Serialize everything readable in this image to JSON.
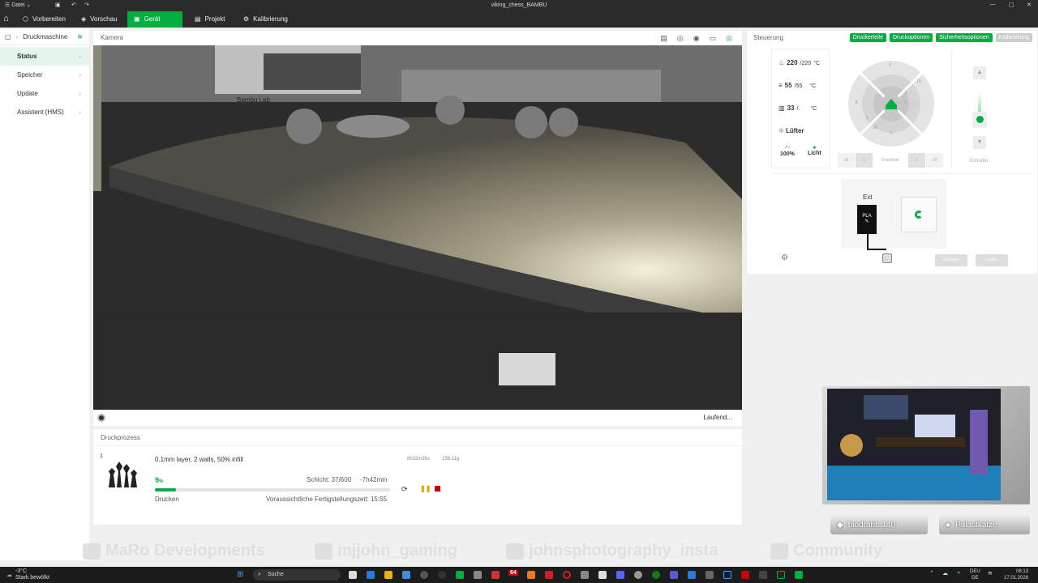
{
  "titlebar": {
    "file_menu": "Datei",
    "title": "viking_chess_BAMBU"
  },
  "nav": {
    "tabs": [
      {
        "label": "Vorbereiten",
        "icon": "cube-icon"
      },
      {
        "label": "Vorschau",
        "icon": "layers-icon"
      },
      {
        "label": "Gerät",
        "icon": "device-icon",
        "active": true
      },
      {
        "label": "Projekt",
        "icon": "project-icon"
      },
      {
        "label": "Kalibrierung",
        "icon": "calibration-icon"
      }
    ]
  },
  "sidebar": {
    "title": "Druckmaschine",
    "items": [
      "Status",
      "Speicher",
      "Update",
      "Assistent (HMS)"
    ]
  },
  "camera": {
    "label": "Kamera",
    "status": "Laufend..."
  },
  "process": {
    "label": "Druckprozess",
    "plate_index": "1",
    "job": "0.1mm layer, 2 walls, 50% infill",
    "time_total": "8h32m36s",
    "weight": "158,11g",
    "percent": "9",
    "percent_unit": "%",
    "progress": 0.09,
    "layer": "Schicht: 37/600",
    "remaining": "-7h42min",
    "state": "Drucken",
    "finish": "Voraussichtliche Fertigstellungszeit: 15:55"
  },
  "control": {
    "label": "Steuerung",
    "buttons": [
      "Druckerteile",
      "Druckoptionen",
      "Sicherheitsoptionen",
      "Kalibrierung"
    ],
    "nozzle": {
      "current": "220",
      "target": "/220",
      "unit": "°C"
    },
    "bed": {
      "current": "55",
      "target": "/55",
      "unit": "°C"
    },
    "chamber": {
      "current": "33",
      "target": "/.",
      "unit": "°C"
    },
    "fan_label": "Lüfter",
    "fan_value": "100%",
    "light_label": "Licht",
    "dpad_labels": [
      "Y",
      "X",
      "-X",
      "-Y",
      "10",
      "1",
      "10",
      "1"
    ],
    "z_labels": [
      "10",
      "1",
      "Druckbett",
      "1",
      "10"
    ],
    "extruder_label": "Extruder",
    "ams": {
      "ext_label": "Ext",
      "filament": "PLA",
      "btn_unload": "Entladen",
      "btn_load": "Laden"
    }
  },
  "stream": {
    "badge1": "biodraht: 140",
    "badge2": "Palastkatze"
  },
  "banner": [
    "MaRo Developments",
    "mjjohn_gaming",
    "johnsphotography_insta",
    "Community"
  ],
  "taskbar": {
    "weather_temp": "-3°C",
    "weather_desc": "Stark bewölkt",
    "search": "Suche",
    "lang1": "DEU",
    "lang2": "DE",
    "time": "08:13",
    "date": "17.01.2026",
    "app_label": "64"
  },
  "colors": {
    "accent": "#00ae42",
    "dark": "#2b2b2b"
  }
}
